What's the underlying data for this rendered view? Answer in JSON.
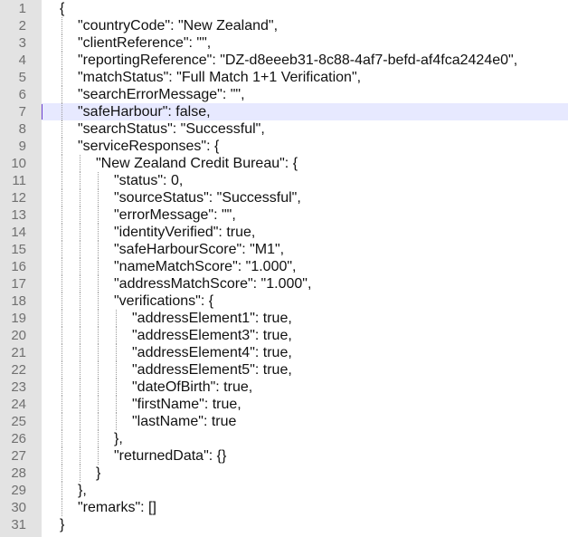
{
  "editor": {
    "highlighted_line": 7,
    "colors": {
      "gutter_background": "#e3e3e3",
      "line_number_text": "#707070",
      "highlight_background": "#e7e9ff",
      "code_text": "#111111"
    },
    "lines": [
      {
        "number": "1",
        "indent": 0,
        "text": "{"
      },
      {
        "number": "2",
        "indent": 1,
        "text": "\"countryCode\": \"New Zealand\","
      },
      {
        "number": "3",
        "indent": 1,
        "text": "\"clientReference\": \"\","
      },
      {
        "number": "4",
        "indent": 1,
        "text": "\"reportingReference\": \"DZ-d8eeeb31-8c88-4af7-befd-af4fca2424e0\","
      },
      {
        "number": "5",
        "indent": 1,
        "text": "\"matchStatus\": \"Full Match 1+1 Verification\","
      },
      {
        "number": "6",
        "indent": 1,
        "text": "\"searchErrorMessage\": \"\","
      },
      {
        "number": "7",
        "indent": 1,
        "text": "\"safeHarbour\": false,"
      },
      {
        "number": "8",
        "indent": 1,
        "text": "\"searchStatus\": \"Successful\","
      },
      {
        "number": "9",
        "indent": 1,
        "text": "\"serviceResponses\": {"
      },
      {
        "number": "10",
        "indent": 2,
        "text": "\"New Zealand Credit Bureau\": {"
      },
      {
        "number": "11",
        "indent": 3,
        "text": "\"status\": 0,"
      },
      {
        "number": "12",
        "indent": 3,
        "text": "\"sourceStatus\": \"Successful\","
      },
      {
        "number": "13",
        "indent": 3,
        "text": "\"errorMessage\": \"\","
      },
      {
        "number": "14",
        "indent": 3,
        "text": "\"identityVerified\": true,"
      },
      {
        "number": "15",
        "indent": 3,
        "text": "\"safeHarbourScore\": \"M1\","
      },
      {
        "number": "16",
        "indent": 3,
        "text": "\"nameMatchScore\": \"1.000\","
      },
      {
        "number": "17",
        "indent": 3,
        "text": "\"addressMatchScore\": \"1.000\","
      },
      {
        "number": "18",
        "indent": 3,
        "text": "\"verifications\": {"
      },
      {
        "number": "19",
        "indent": 4,
        "text": "\"addressElement1\": true,"
      },
      {
        "number": "20",
        "indent": 4,
        "text": "\"addressElement3\": true,"
      },
      {
        "number": "21",
        "indent": 4,
        "text": "\"addressElement4\": true,"
      },
      {
        "number": "22",
        "indent": 4,
        "text": "\"addressElement5\": true,"
      },
      {
        "number": "23",
        "indent": 4,
        "text": "\"dateOfBirth\": true,"
      },
      {
        "number": "24",
        "indent": 4,
        "text": "\"firstName\": true,"
      },
      {
        "number": "25",
        "indent": 4,
        "text": "\"lastName\": true"
      },
      {
        "number": "26",
        "indent": 3,
        "text": "},"
      },
      {
        "number": "27",
        "indent": 3,
        "text": "\"returnedData\": {}"
      },
      {
        "number": "28",
        "indent": 2,
        "text": "}"
      },
      {
        "number": "29",
        "indent": 1,
        "text": "},"
      },
      {
        "number": "30",
        "indent": 1,
        "text": "\"remarks\": []"
      },
      {
        "number": "31",
        "indent": 0,
        "text": "}"
      }
    ]
  }
}
